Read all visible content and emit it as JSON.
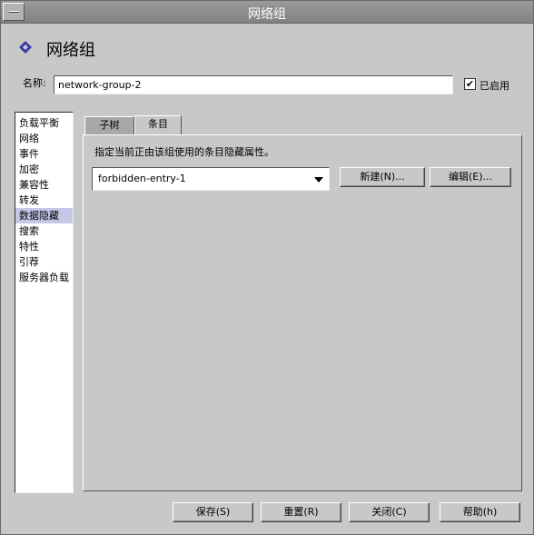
{
  "window": {
    "title": "网络组"
  },
  "header": {
    "title": "网络组"
  },
  "name_field": {
    "label": "名称:",
    "value": "network-group-2"
  },
  "enabled": {
    "label": "已启用",
    "checked": true,
    "mark": "✔"
  },
  "sidebar": {
    "items": [
      {
        "label": "负载平衡"
      },
      {
        "label": "网络"
      },
      {
        "label": "事件"
      },
      {
        "label": "加密"
      },
      {
        "label": "兼容性"
      },
      {
        "label": "转发"
      },
      {
        "label": "数据隐藏",
        "selected": true
      },
      {
        "label": "搜索"
      },
      {
        "label": "特性"
      },
      {
        "label": "引荐"
      },
      {
        "label": "服务器负载"
      }
    ]
  },
  "tabs": [
    {
      "label": "子树"
    },
    {
      "label": "条目",
      "active": true
    }
  ],
  "entry_panel": {
    "description": "指定当前正由该组使用的条目隐藏属性。",
    "selected_entry": "forbidden-entry-1",
    "new_button": "新建(N)...",
    "edit_button": "编辑(E)..."
  },
  "footer": {
    "save": "保存(S)",
    "reset": "重置(R)",
    "close": "关闭(C)",
    "help": "帮助(h)"
  },
  "colors": {
    "icon_accent": "#3a3aa0",
    "selected_bg": "#c6c6e8"
  }
}
